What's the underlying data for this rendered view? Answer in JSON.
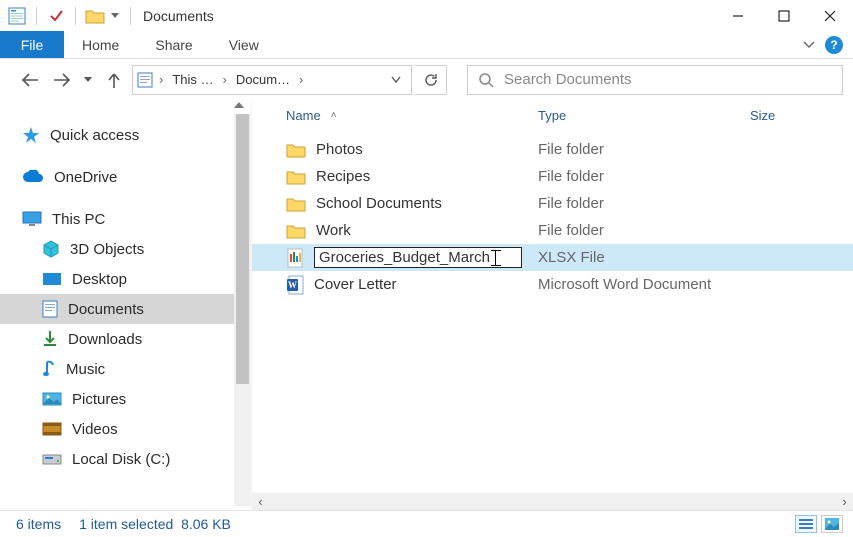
{
  "title": "Documents",
  "ribbon": {
    "file": "File",
    "home": "Home",
    "share": "Share",
    "view": "View"
  },
  "breadcrumb": {
    "root": "This …",
    "current": "Docum…"
  },
  "search": {
    "placeholder": "Search Documents"
  },
  "nav": {
    "quick_access": "Quick access",
    "onedrive": "OneDrive",
    "this_pc": "This PC",
    "items": {
      "3d_objects": "3D Objects",
      "desktop": "Desktop",
      "documents": "Documents",
      "downloads": "Downloads",
      "music": "Music",
      "pictures": "Pictures",
      "videos": "Videos",
      "local_disk": "Local Disk (C:)"
    }
  },
  "columns": {
    "name": "Name",
    "type": "Type",
    "size": "Size"
  },
  "files": [
    {
      "name": "Photos",
      "type": "File folder",
      "kind": "folder"
    },
    {
      "name": "Recipes",
      "type": "File folder",
      "kind": "folder"
    },
    {
      "name": "School Documents",
      "type": "File folder",
      "kind": "folder"
    },
    {
      "name": "Work",
      "type": "File folder",
      "kind": "folder"
    },
    {
      "name": "Groceries_Budget_March",
      "type": "XLSX File",
      "kind": "xlsx",
      "editing": true,
      "selected": true
    },
    {
      "name": "Cover Letter",
      "type": "Microsoft Word Document",
      "kind": "word"
    }
  ],
  "status": {
    "count": "6 items",
    "selection": "1 item selected",
    "size": "8.06 KB"
  }
}
